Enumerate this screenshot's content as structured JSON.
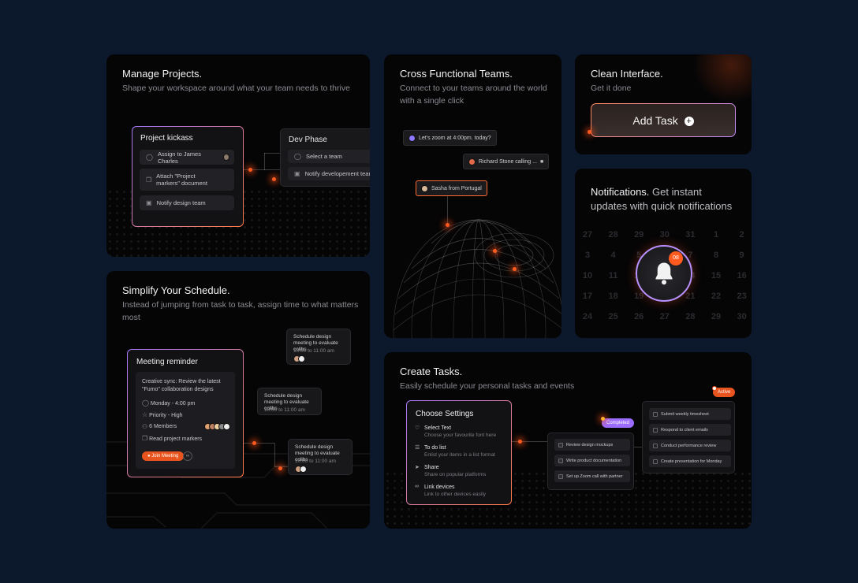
{
  "colors": {
    "accent": "#ff5a1f",
    "purple": "#a978ff",
    "background": "#0c182b",
    "card": "#050506"
  },
  "projects": {
    "title": "Manage Projects.",
    "subtitle": "Shape your workspace around what your team needs to  thrive",
    "kick_title": "Project kickass",
    "items": [
      {
        "icon": "user-circle-icon",
        "label": "Assign to James Charles"
      },
      {
        "icon": "copy-icon",
        "label": "Attach \"Project markers\" document"
      },
      {
        "icon": "bell-icon",
        "label": "Notify design team"
      }
    ],
    "dev_title": "Dev Phase",
    "dev_items": [
      {
        "icon": "user-circle-icon",
        "label": "Select a team"
      },
      {
        "icon": "bell-icon",
        "label": "Notify developement team"
      }
    ]
  },
  "teams": {
    "title": "Cross Functional Teams.",
    "subtitle": "Connect to your teams around the world with a single click",
    "chip1": "Let's zoom at 4:00pm. today?",
    "chip2": "Richard Stone calling ...",
    "chip3": "Sasha from Portugal"
  },
  "clean": {
    "title": "Clean Interface.",
    "subtitle": "Get it done",
    "button": "Add Task"
  },
  "notifications": {
    "title_bold": "Notifications.",
    "title_rest": " Get instant",
    "title_line2": "updates with quick notifications",
    "badge": "08",
    "calendar": [
      "27",
      "28",
      "29",
      "30",
      "31",
      "1",
      "2",
      "3",
      "4",
      "5",
      "6",
      "7",
      "8",
      "9",
      "10",
      "11",
      "12",
      "13",
      "14",
      "15",
      "16",
      "17",
      "18",
      "19",
      "20",
      "21",
      "22",
      "23",
      "24",
      "25",
      "26",
      "27",
      "28",
      "29",
      "30"
    ]
  },
  "schedule": {
    "title": "Simplify Your Schedule.",
    "subtitle": "Instead of jumping from task to task, assign time to what matters most",
    "card_title": "Meeting reminder",
    "desc": "Creative sync: Review the latest \"Fumo\" collaboration designs",
    "date": "Monday - 4:00 pm",
    "priority": "Priority - High",
    "members": "6 Members",
    "read": "Read project markers",
    "join": "Join Meeting",
    "mini_title": "Schedule design meeting to evaluate collbs",
    "mini_time": "10:00 to 11:00 am"
  },
  "tasks": {
    "title": "Create Tasks.",
    "subtitle": "Easily schedule your personal tasks and events",
    "settings_title": "Choose Settings",
    "settings": [
      {
        "icon": "heart-icon",
        "label": "Select Text",
        "desc": "Choose your favourite font here"
      },
      {
        "icon": "list-icon",
        "label": "To do list",
        "desc": "Enlist your items in a list format"
      },
      {
        "icon": "share-icon",
        "label": "Share",
        "desc": "Share on popular platforms"
      },
      {
        "icon": "link-icon",
        "label": "Link devices",
        "desc": "Link to other devices easily"
      }
    ],
    "completed_badge": "Completed",
    "completed": [
      "Review design mockups",
      "Write product documentation",
      "Set up Zoom call with partner"
    ],
    "active_badge": "Active",
    "active": [
      "Submit weekly timesheet",
      "Respond to client emails",
      "Conduct performance review",
      "Create presentation for Monday"
    ]
  }
}
